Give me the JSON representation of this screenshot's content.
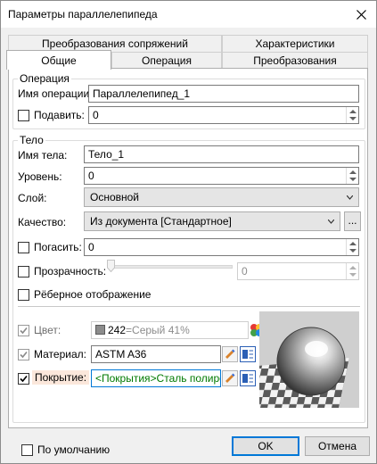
{
  "window": {
    "title": "Параметры параллелепипеда"
  },
  "tabs_top": [
    {
      "label": "Преобразования сопряжений"
    },
    {
      "label": "Характеристики"
    }
  ],
  "tabs_bottom": [
    {
      "label": "Общие",
      "active": true
    },
    {
      "label": "Операция"
    },
    {
      "label": "Преобразования"
    }
  ],
  "operation": {
    "group_title": "Операция",
    "name_label": "Имя операции:",
    "name_value": "Параллелепипед_1",
    "suppress_label": "Подавить:",
    "suppress_checked": false,
    "suppress_value": "0"
  },
  "body": {
    "group_title": "Тело",
    "body_name_label": "Имя тела:",
    "body_name_value": "Тело_1",
    "level_label": "Уровень:",
    "level_value": "0",
    "layer_label": "Слой:",
    "layer_value": "Основной",
    "quality_label": "Качество:",
    "quality_value": "Из документа [Стандартное]",
    "quality_more": "...",
    "hide_label": "Погасить:",
    "hide_checked": false,
    "hide_value": "0",
    "transparency_label": "Прозрачность:",
    "transparency_checked": false,
    "transparency_value": "0",
    "transparency_level": 0,
    "edge_display_label": "Рёберное отображение",
    "edge_display_checked": false,
    "color_label": "Цвет:",
    "color_checked": true,
    "color_number": "242",
    "color_name": "=Серый 41%",
    "color_swatch": "#8c8c8c",
    "material_label": "Материал:",
    "material_checked": true,
    "material_value": "ASTM A36",
    "coating_label": "Покрытие:",
    "coating_checked": true,
    "coating_value": "<Покрытия>Сталь полиров",
    "coating_text_color": "#007a00",
    "coating_label_bg": "#fbe7db"
  },
  "footer": {
    "default_label": "По умолчанию",
    "default_checked": false,
    "ok_label": "OK",
    "cancel_label": "Отмена"
  },
  "colors": {
    "accent": "#0078d7"
  }
}
